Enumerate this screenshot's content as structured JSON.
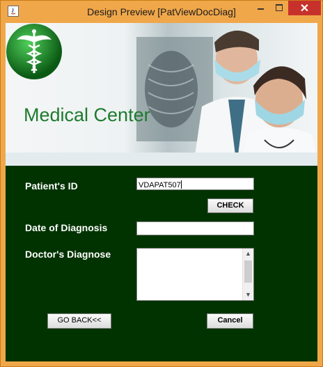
{
  "window": {
    "title": "Design Preview [PatViewDocDiag]",
    "close_glyph": "✕"
  },
  "banner": {
    "brand": "Medical Center"
  },
  "form": {
    "patient_id_label": "Patient's ID",
    "patient_id_value": "VDAPAT507",
    "check_label": "CHECK",
    "date_label": "Date of Diagnosis",
    "date_value": "",
    "diagnose_label": "Doctor's Diagnose",
    "diagnose_value": "",
    "go_back_label": "GO BACK<<",
    "cancel_label": "Cancel"
  },
  "colors": {
    "panel": "#003300",
    "brand": "#1d7a2e",
    "titlebar": "#f0a74a",
    "close": "#c7312b"
  }
}
